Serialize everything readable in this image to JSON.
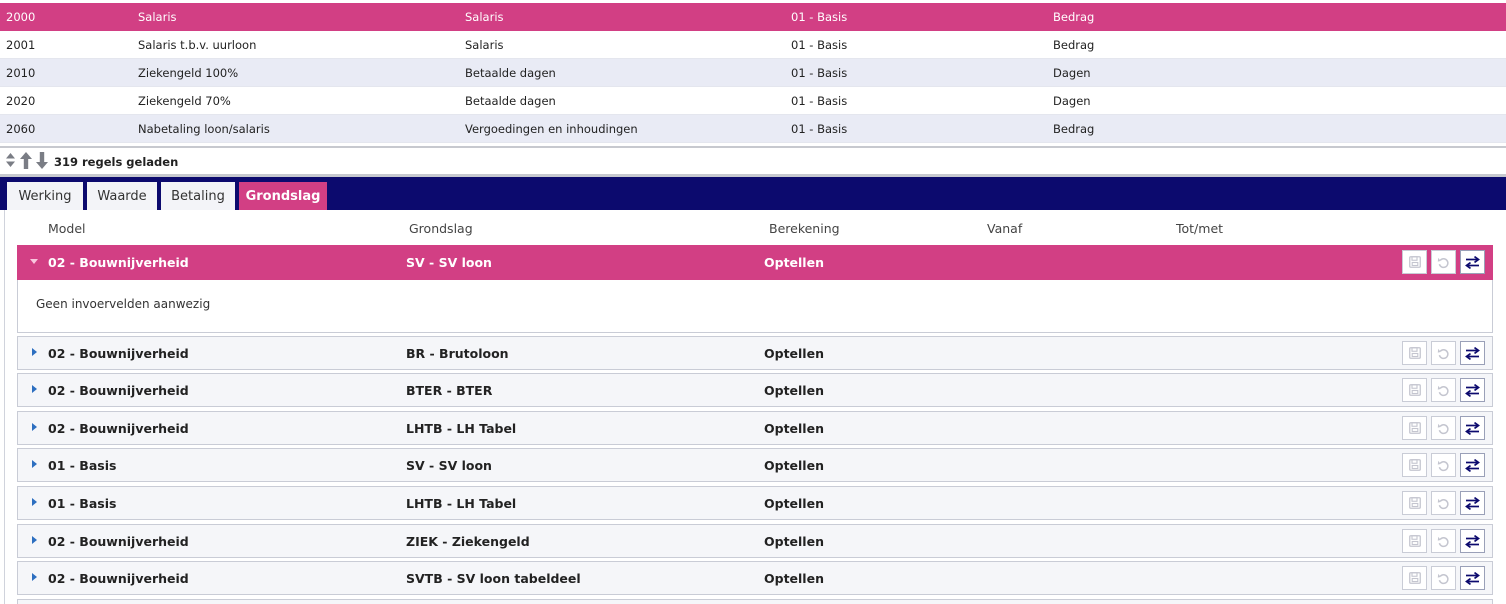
{
  "top_table": {
    "rows": [
      {
        "code": "2000",
        "name": "Salaris",
        "group": "Salaris",
        "model": "01 - Basis",
        "type": "Bedrag",
        "selected": true
      },
      {
        "code": "2001",
        "name": "Salaris t.b.v. uurloon",
        "group": "Salaris",
        "model": "01 - Basis",
        "type": "Bedrag"
      },
      {
        "code": "2010",
        "name": "Ziekengeld 100%",
        "group": "Betaalde dagen",
        "model": "01 - Basis",
        "type": "Dagen"
      },
      {
        "code": "2020",
        "name": "Ziekengeld 70%",
        "group": "Betaalde dagen",
        "model": "01 - Basis",
        "type": "Dagen"
      },
      {
        "code": "2060",
        "name": "Nabetaling loon/salaris",
        "group": "Vergoedingen en inhoudingen",
        "model": "01 - Basis",
        "type": "Bedrag"
      }
    ]
  },
  "status": {
    "loaded_text": "319 regels geladen",
    "icons": [
      "sort-icon",
      "arrow-up-icon",
      "arrow-down-icon"
    ]
  },
  "tabs": [
    {
      "label": "Werking"
    },
    {
      "label": "Waarde"
    },
    {
      "label": "Betaling"
    },
    {
      "label": "Grondslag",
      "active": true
    }
  ],
  "grid": {
    "headers": {
      "model": "Model",
      "grondslag": "Grondslag",
      "berekening": "Berekening",
      "vanaf": "Vanaf",
      "totmet": "Tot/met"
    },
    "expanded_detail": "Geen invoervelden aanwezig",
    "rows": [
      {
        "model": "02 - Bouwnijverheid",
        "grondslag": "SV - SV loon",
        "berekening": "Optellen",
        "expanded": true
      },
      {
        "model": "02 - Bouwnijverheid",
        "grondslag": "BR - Brutoloon",
        "berekening": "Optellen"
      },
      {
        "model": "02 - Bouwnijverheid",
        "grondslag": "BTER - BTER",
        "berekening": "Optellen"
      },
      {
        "model": "02 - Bouwnijverheid",
        "grondslag": "LHTB - LH Tabel",
        "berekening": "Optellen"
      },
      {
        "model": "01 - Basis",
        "grondslag": "SV - SV loon",
        "berekening": "Optellen"
      },
      {
        "model": "01 - Basis",
        "grondslag": "LHTB - LH Tabel",
        "berekening": "Optellen"
      },
      {
        "model": "02 - Bouwnijverheid",
        "grondslag": "ZIEK - Ziekengeld",
        "berekening": "Optellen"
      },
      {
        "model": "02 - Bouwnijverheid",
        "grondslag": "SVTB - SV loon tabeldeel",
        "berekening": "Optellen"
      }
    ],
    "row_action_icons": [
      "save-icon",
      "undo-icon",
      "swap-icon"
    ]
  },
  "colors": {
    "accent": "#d23f84",
    "navy": "#0c0a6e",
    "row_alt": "#e9ebf5"
  }
}
